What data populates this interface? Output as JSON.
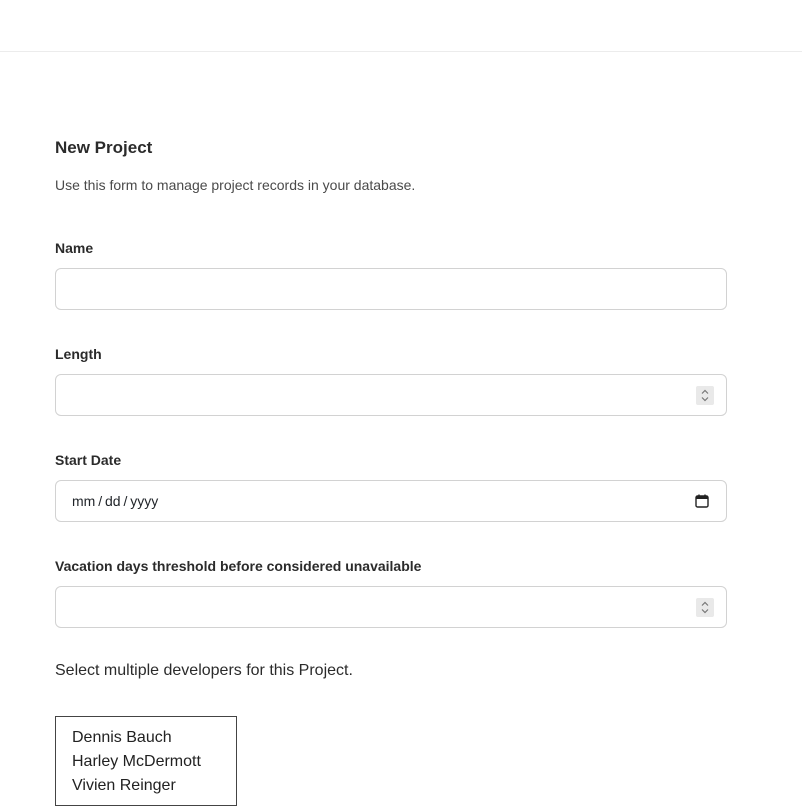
{
  "form": {
    "title": "New Project",
    "subtitle": "Use this form to manage project records in your database.",
    "fields": {
      "name": {
        "label": "Name",
        "value": ""
      },
      "length": {
        "label": "Length",
        "value": ""
      },
      "start_date": {
        "label": "Start Date",
        "placeholder": "mm / dd / yyyy"
      },
      "vacation_threshold": {
        "label": "Vacation days threshold before considered unavailable",
        "value": ""
      }
    },
    "developers": {
      "helper": "Select multiple developers for this Project.",
      "options": [
        "Dennis Bauch",
        "Harley McDermott",
        "Vivien Reinger"
      ]
    }
  },
  "icons": {
    "spinner": "spinner-arrows-icon",
    "calendar": "calendar-icon"
  }
}
